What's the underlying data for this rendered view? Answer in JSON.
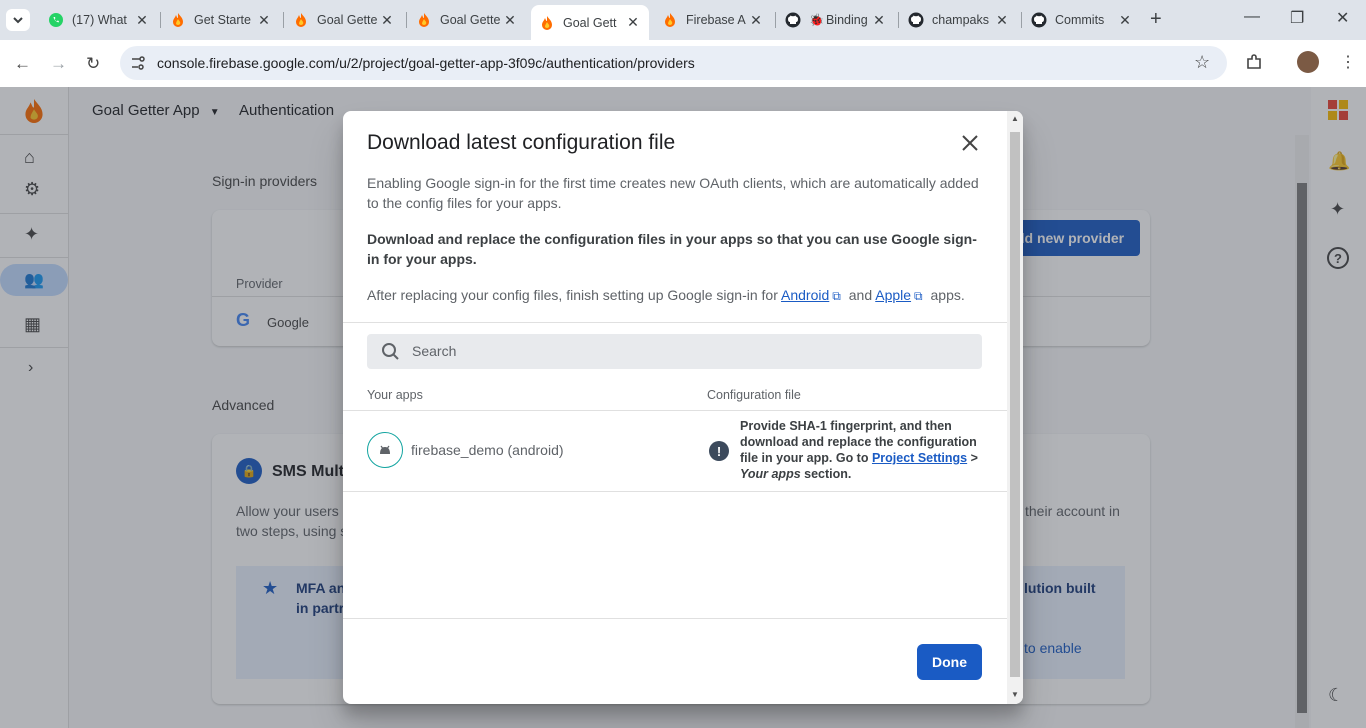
{
  "browser": {
    "tabs": [
      {
        "title": "(17) What",
        "icon": "whatsapp-icon"
      },
      {
        "title": "Get Starte",
        "icon": "firebase-icon"
      },
      {
        "title": "Goal Gette",
        "icon": "firebase-icon"
      },
      {
        "title": "Goal Gette",
        "icon": "firebase-icon"
      },
      {
        "title": "Goal Gett",
        "icon": "firebase-icon",
        "active": true
      },
      {
        "title": "Firebase A",
        "icon": "firebase-icon"
      },
      {
        "title": "Binding",
        "icon": "github-icon"
      },
      {
        "title": "champaks",
        "icon": "github-icon"
      },
      {
        "title": "Commits",
        "icon": "github-icon"
      }
    ],
    "url": "console.firebase.google.com/u/2/project/goal-getter-app-3f09c/authentication/providers"
  },
  "console": {
    "project_name": "Goal Getter App",
    "section": "Authentication",
    "signin_providers_label": "Sign-in providers",
    "add_provider_label": "dd new provider",
    "provider_col": "Provider",
    "provider_google": "Google",
    "advanced_label": "Advanced",
    "sms_title": "SMS Mult",
    "sms_desc_1": "Allow your users",
    "sms_desc_2": "two steps, using s",
    "sms_desc_right": "their account in",
    "mfa_text_1": "MFA an",
    "mfa_text_2": "in partr",
    "mfa_right_1": "lution built",
    "mfa_right_2": "to enable"
  },
  "dialog": {
    "title": "Download latest configuration file",
    "para1": "Enabling Google sign-in for the first time creates new OAuth clients, which are automatically added to the config files for your apps.",
    "para2": "Download and replace the configuration files in your apps so that you can use Google sign-in for your apps.",
    "para3_prefix": "After replacing your config files, finish setting up Google sign-in for",
    "android_link": "Android",
    "and_text": "and",
    "apple_link": "Apple",
    "apps_suffix": "apps.",
    "search_placeholder": "Search",
    "col_apps": "Your apps",
    "col_config": "Configuration file",
    "app_name": "firebase_demo (android)",
    "config_msg_1": "Provide SHA-1 fingerprint, and then download and replace the configuration file in your app. Go to",
    "project_settings_link": "Project Settings",
    "config_msg_gt": ">",
    "your_apps_italic": "Your apps",
    "config_msg_end": "section.",
    "done_label": "Done"
  },
  "colors": {
    "primary": "#1a5bc4",
    "teal": "#12a4a0",
    "firebase_orange": "#ff8f00"
  }
}
